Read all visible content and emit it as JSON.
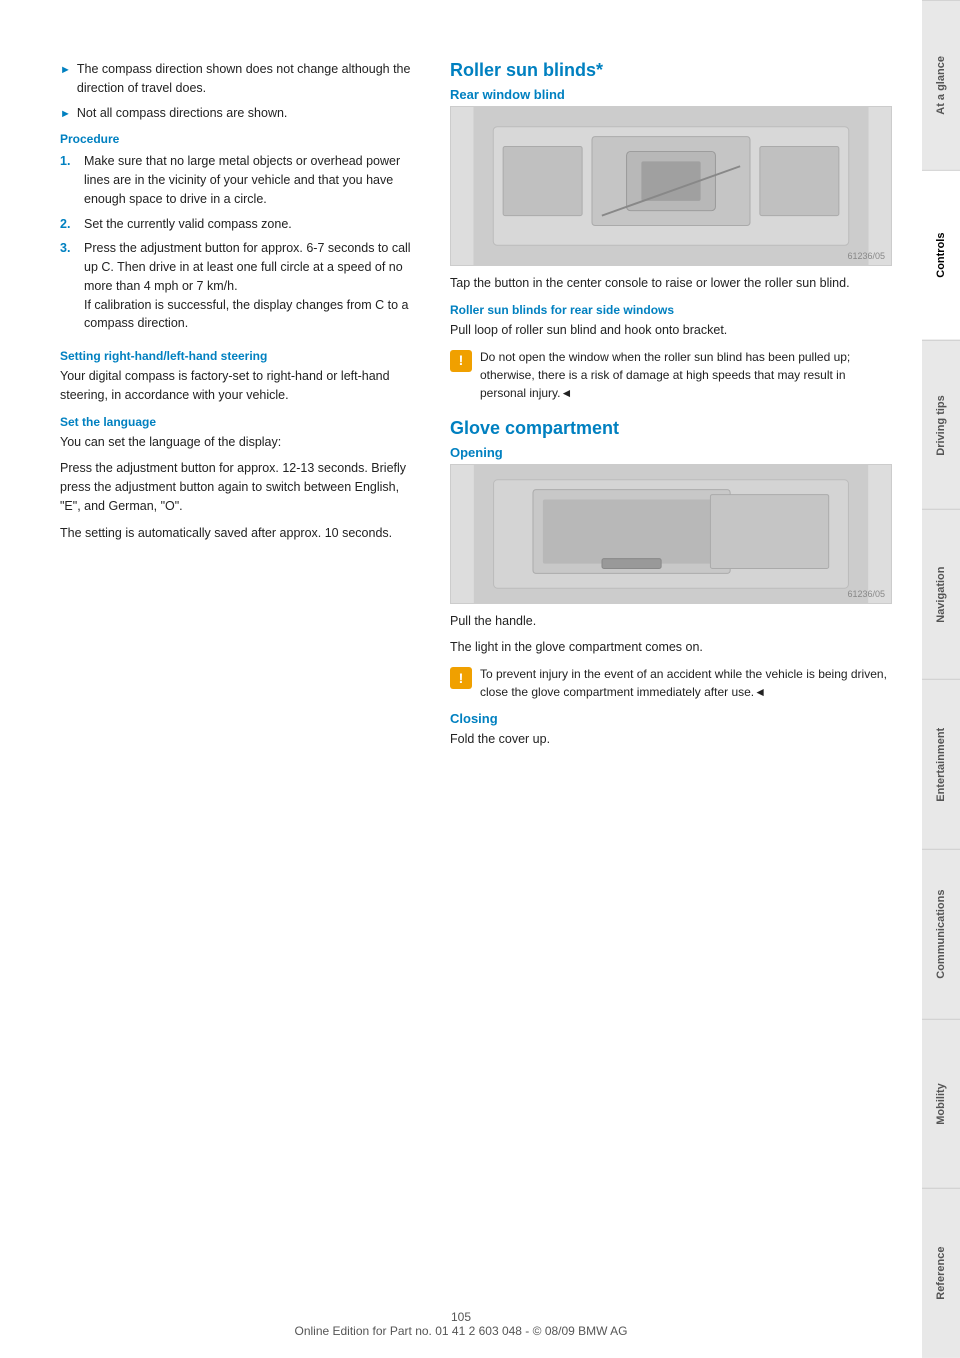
{
  "sidebar": {
    "tabs": [
      {
        "id": "at-a-glance",
        "label": "At a glance",
        "active": false
      },
      {
        "id": "controls",
        "label": "Controls",
        "active": true
      },
      {
        "id": "driving-tips",
        "label": "Driving tips",
        "active": false
      },
      {
        "id": "navigation",
        "label": "Navigation",
        "active": false
      },
      {
        "id": "entertainment",
        "label": "Entertainment",
        "active": false
      },
      {
        "id": "communications",
        "label": "Communications",
        "active": false
      },
      {
        "id": "mobility",
        "label": "Mobility",
        "active": false
      },
      {
        "id": "reference",
        "label": "Reference",
        "active": false
      }
    ]
  },
  "left_column": {
    "bullets": [
      "The compass direction shown does not change although the direction of travel does.",
      "Not all compass directions are shown."
    ],
    "procedure": {
      "title": "Procedure",
      "steps": [
        "Make sure that no large metal objects or overhead power lines are in the vicinity of your vehicle and that you have enough space to drive in a circle.",
        "Set the currently valid compass zone.",
        "Press the adjustment button for approx. 6-7 seconds to call up C. Then drive in at least one full circle at a speed of no more than 4 mph or 7 km/h.\nIf calibration is successful, the display changes from C to a compass direction."
      ]
    },
    "setting_steering": {
      "title": "Setting right-hand/left-hand steering",
      "body": "Your digital compass is factory-set to right-hand or left-hand steering, in accordance with your vehicle."
    },
    "set_language": {
      "title": "Set the language",
      "body1": "You can set the language of the display:",
      "body2": "Press the adjustment button for approx. 12-13 seconds. Briefly press the adjustment button again to switch between English, \"E\", and German, \"O\".",
      "body3": "The setting is automatically saved after approx. 10 seconds."
    }
  },
  "right_column": {
    "roller_sun_blinds": {
      "title": "Roller sun blinds*",
      "rear_window": {
        "subtitle": "Rear window blind",
        "description": "Tap the button in the center console to raise or lower the roller sun blind."
      },
      "rear_side": {
        "subtitle": "Roller sun blinds for rear side windows",
        "description": "Pull loop of roller sun blind and hook onto bracket.",
        "warning": "Do not open the window when the roller sun blind has been pulled up; otherwise, there is a risk of damage at high speeds that may result in personal injury.◄"
      }
    },
    "glove_compartment": {
      "title": "Glove compartment",
      "opening": {
        "subtitle": "Opening",
        "description1": "Pull the handle.",
        "description2": "The light in the glove compartment comes on.",
        "warning": "To prevent injury in the event of an accident while the vehicle is being driven, close the glove compartment immediately after use.◄"
      },
      "closing": {
        "subtitle": "Closing",
        "description": "Fold the cover up."
      }
    }
  },
  "footer": {
    "page_number": "105",
    "copyright": "Online Edition for Part no. 01 41 2 603 048 - © 08/09 BMW AG"
  }
}
